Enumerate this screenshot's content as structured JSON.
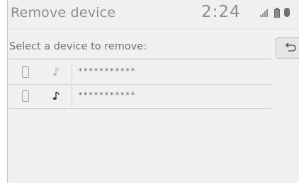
{
  "header": {
    "title": "Remove device",
    "clock": "2:24",
    "icons": [
      "signal-icon",
      "battery-icon",
      "bluetooth-icon"
    ]
  },
  "prompt": {
    "text": "Select a device to remove:"
  },
  "back_button": {
    "icon": "return-arrow-icon"
  },
  "devices": [
    {
      "name": "***********",
      "phone_icon": "phone-icon",
      "audio_icon": "music-note-icon",
      "audio_active": false
    },
    {
      "name": "***********",
      "phone_icon": "phone-icon",
      "audio_icon": "music-note-icon",
      "audio_active": true
    }
  ],
  "colors": {
    "background": "#f0f0f0",
    "text_muted": "#8c8c8c",
    "divider": "#bfbfbf"
  }
}
